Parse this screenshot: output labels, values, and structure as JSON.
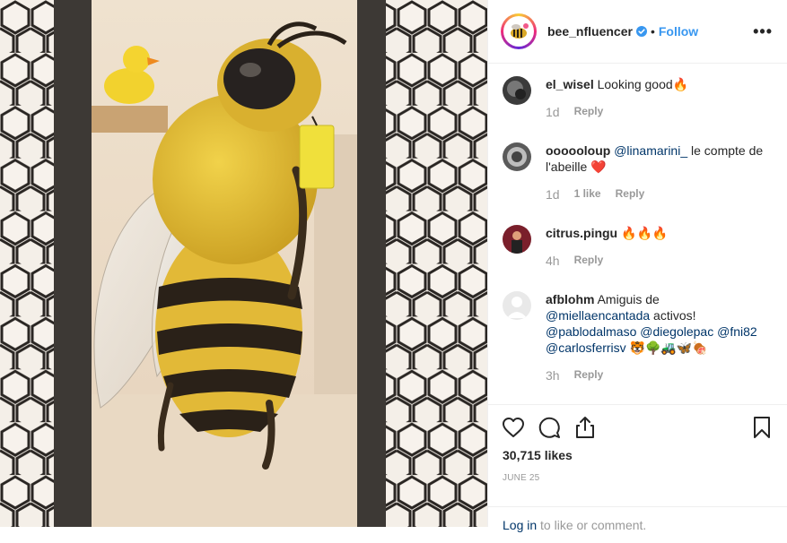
{
  "post": {
    "username": "bee_nfluencer",
    "follow_label": "Follow",
    "separator": "•",
    "more_label": "•••"
  },
  "comments": [
    {
      "user": "el_wisel",
      "text": "Looking good🔥",
      "time": "1d",
      "likes": "",
      "reply": "Reply"
    },
    {
      "user": "oooooloup",
      "mention": "@linamarini_",
      "text": " le compte de l'abeille ❤️",
      "time": "1d",
      "likes": "1 like",
      "reply": "Reply"
    },
    {
      "user": "citrus.pingu",
      "text": "🔥🔥🔥",
      "time": "4h",
      "likes": "",
      "reply": "Reply"
    },
    {
      "user": "afblohm",
      "text_a": "Amiguis de",
      "mention_a": "@miellaencantada",
      "text_b": " activos!",
      "mention_b": "@pablodalmaso",
      "mention_c": "@diegolepac",
      "mention_d": "@fni82",
      "mention_e": "@carlosferrisv",
      "emojis": "🐯🌳🚜🦋🍖",
      "time": "3h",
      "likes": "",
      "reply": "Reply"
    }
  ],
  "likes_count": "30,715 likes",
  "date": "JUNE 25",
  "login": {
    "link": "Log in",
    "rest": " to like or comment."
  },
  "icons": [
    "verified-icon",
    "more-icon",
    "heart-icon",
    "comment-icon",
    "share-icon",
    "bookmark-icon"
  ],
  "colors": {
    "accent": "#3897f0",
    "mention": "#003569",
    "muted": "#999999"
  }
}
